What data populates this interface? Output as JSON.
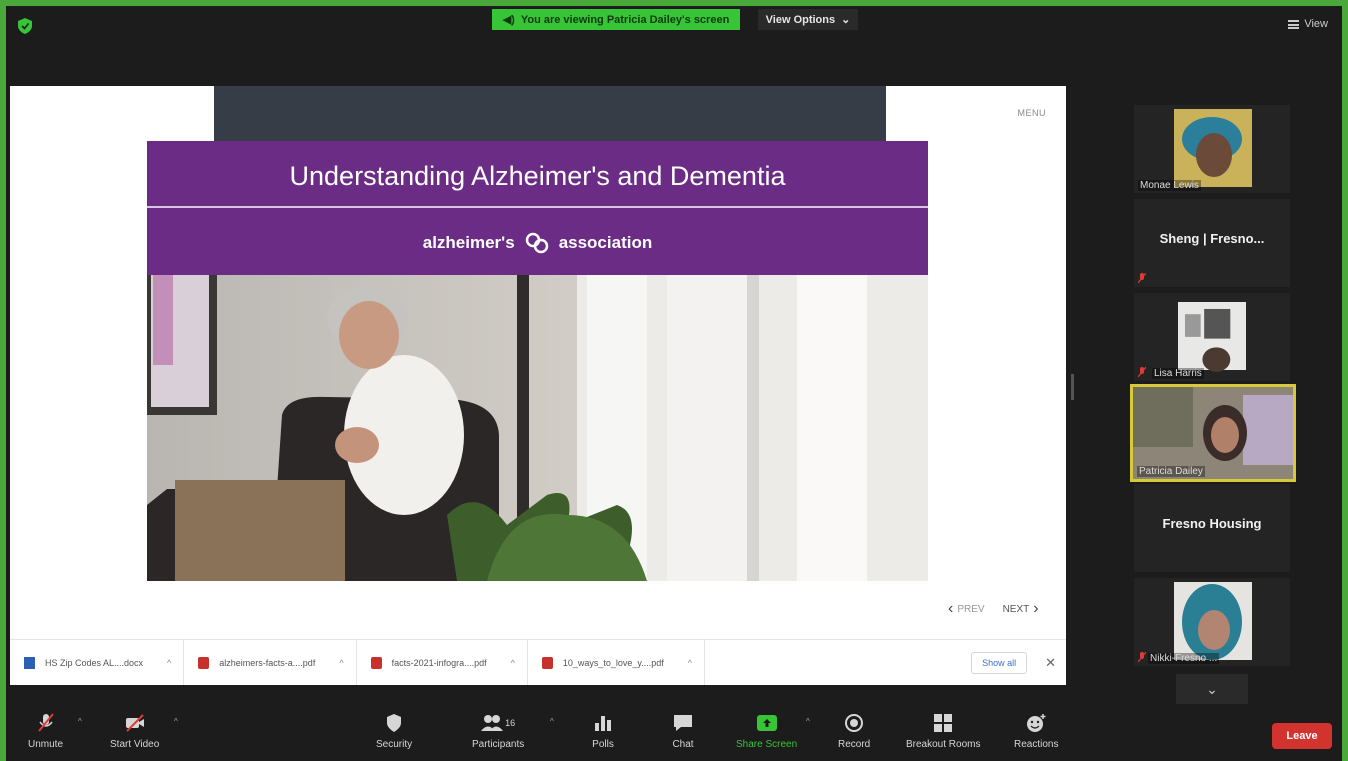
{
  "top_bar": {
    "viewing_banner": "You are viewing Patricia Dailey's screen",
    "view_options": "View Options",
    "view_button": "View"
  },
  "slide": {
    "menu": "MENU",
    "title": "Understanding Alzheimer's and Dementia",
    "logo_left": "alzheimer's",
    "logo_right": "association",
    "prev": "PREV",
    "next": "NEXT"
  },
  "downloads": {
    "items": [
      {
        "name": "HS Zip Codes AL....docx",
        "type": "doc"
      },
      {
        "name": "alzheimers-facts-a....pdf",
        "type": "pdf"
      },
      {
        "name": "facts-2021-infogra....pdf",
        "type": "pdf"
      },
      {
        "name": "10_ways_to_love_y....pdf",
        "type": "pdf"
      }
    ],
    "show_all": "Show all"
  },
  "participants": [
    {
      "name": "Monae Lewis",
      "video": true,
      "muted": false
    },
    {
      "name": "Sheng | Fresno...",
      "video": false,
      "muted": true
    },
    {
      "name": "Lisa Harris",
      "video": true,
      "muted": true
    },
    {
      "name": "Patricia Dailey",
      "video": true,
      "muted": false,
      "active": true
    },
    {
      "name": "Fresno Housing",
      "video": false,
      "muted": false
    },
    {
      "name": "Nikki-Fresno ...",
      "video": true,
      "muted": true
    }
  ],
  "toolbar": {
    "unmute": "Unmute",
    "start_video": "Start Video",
    "security": "Security",
    "participants": "Participants",
    "participants_count": "16",
    "polls": "Polls",
    "chat": "Chat",
    "share_screen": "Share Screen",
    "record": "Record",
    "breakout_rooms": "Breakout Rooms",
    "reactions": "Reactions",
    "leave": "Leave"
  },
  "colors": {
    "frame_green": "#4aa83a",
    "banner_purple": "#6b2c85",
    "active_speaker": "#d8c93b",
    "leave_red": "#d2332e"
  }
}
